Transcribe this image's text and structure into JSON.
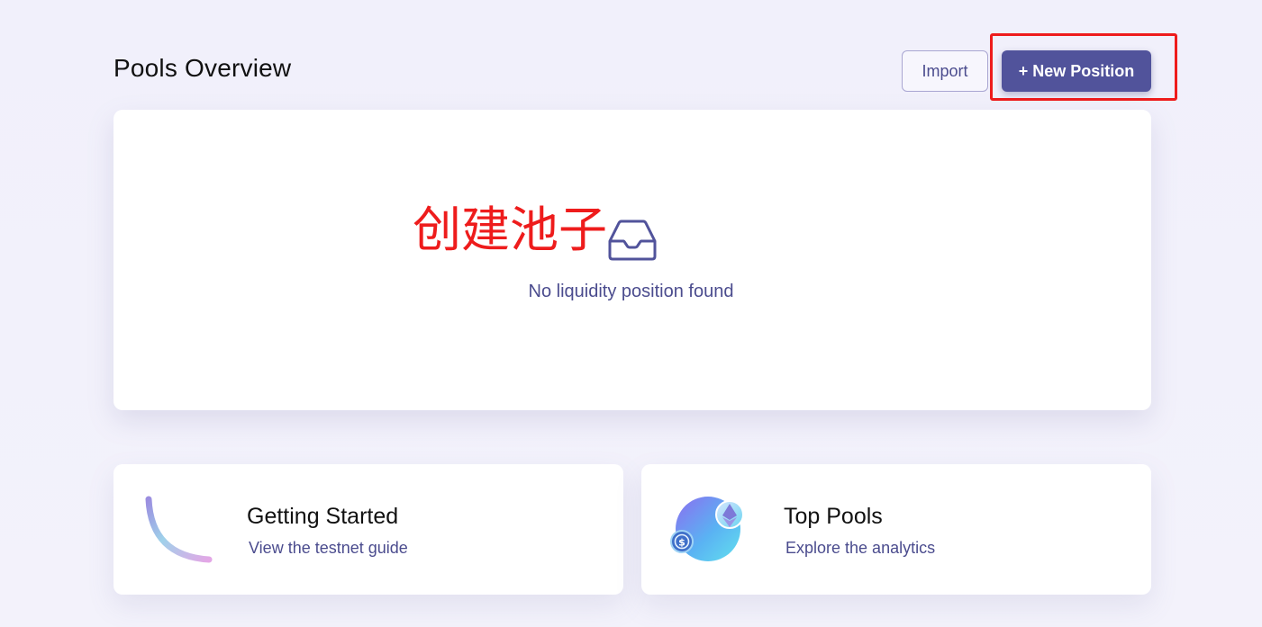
{
  "header": {
    "title": "Pools Overview",
    "import_label": "Import",
    "new_position_label": "+ New Position"
  },
  "annotation": {
    "text": "创建池子",
    "color": "#ee1c1c"
  },
  "empty_state": {
    "icon": "inbox-icon",
    "message": "No liquidity position found"
  },
  "cards": [
    {
      "title": "Getting Started",
      "subtitle": "View the testnet guide",
      "icon": "arc-icon"
    },
    {
      "title": "Top Pools",
      "subtitle": "Explore the analytics",
      "icon": "coins-icon"
    }
  ],
  "colors": {
    "primary": "#51539b",
    "text_muted": "#4b4c8e",
    "background": "#f1f0fb",
    "highlight": "#ee1c1c"
  }
}
